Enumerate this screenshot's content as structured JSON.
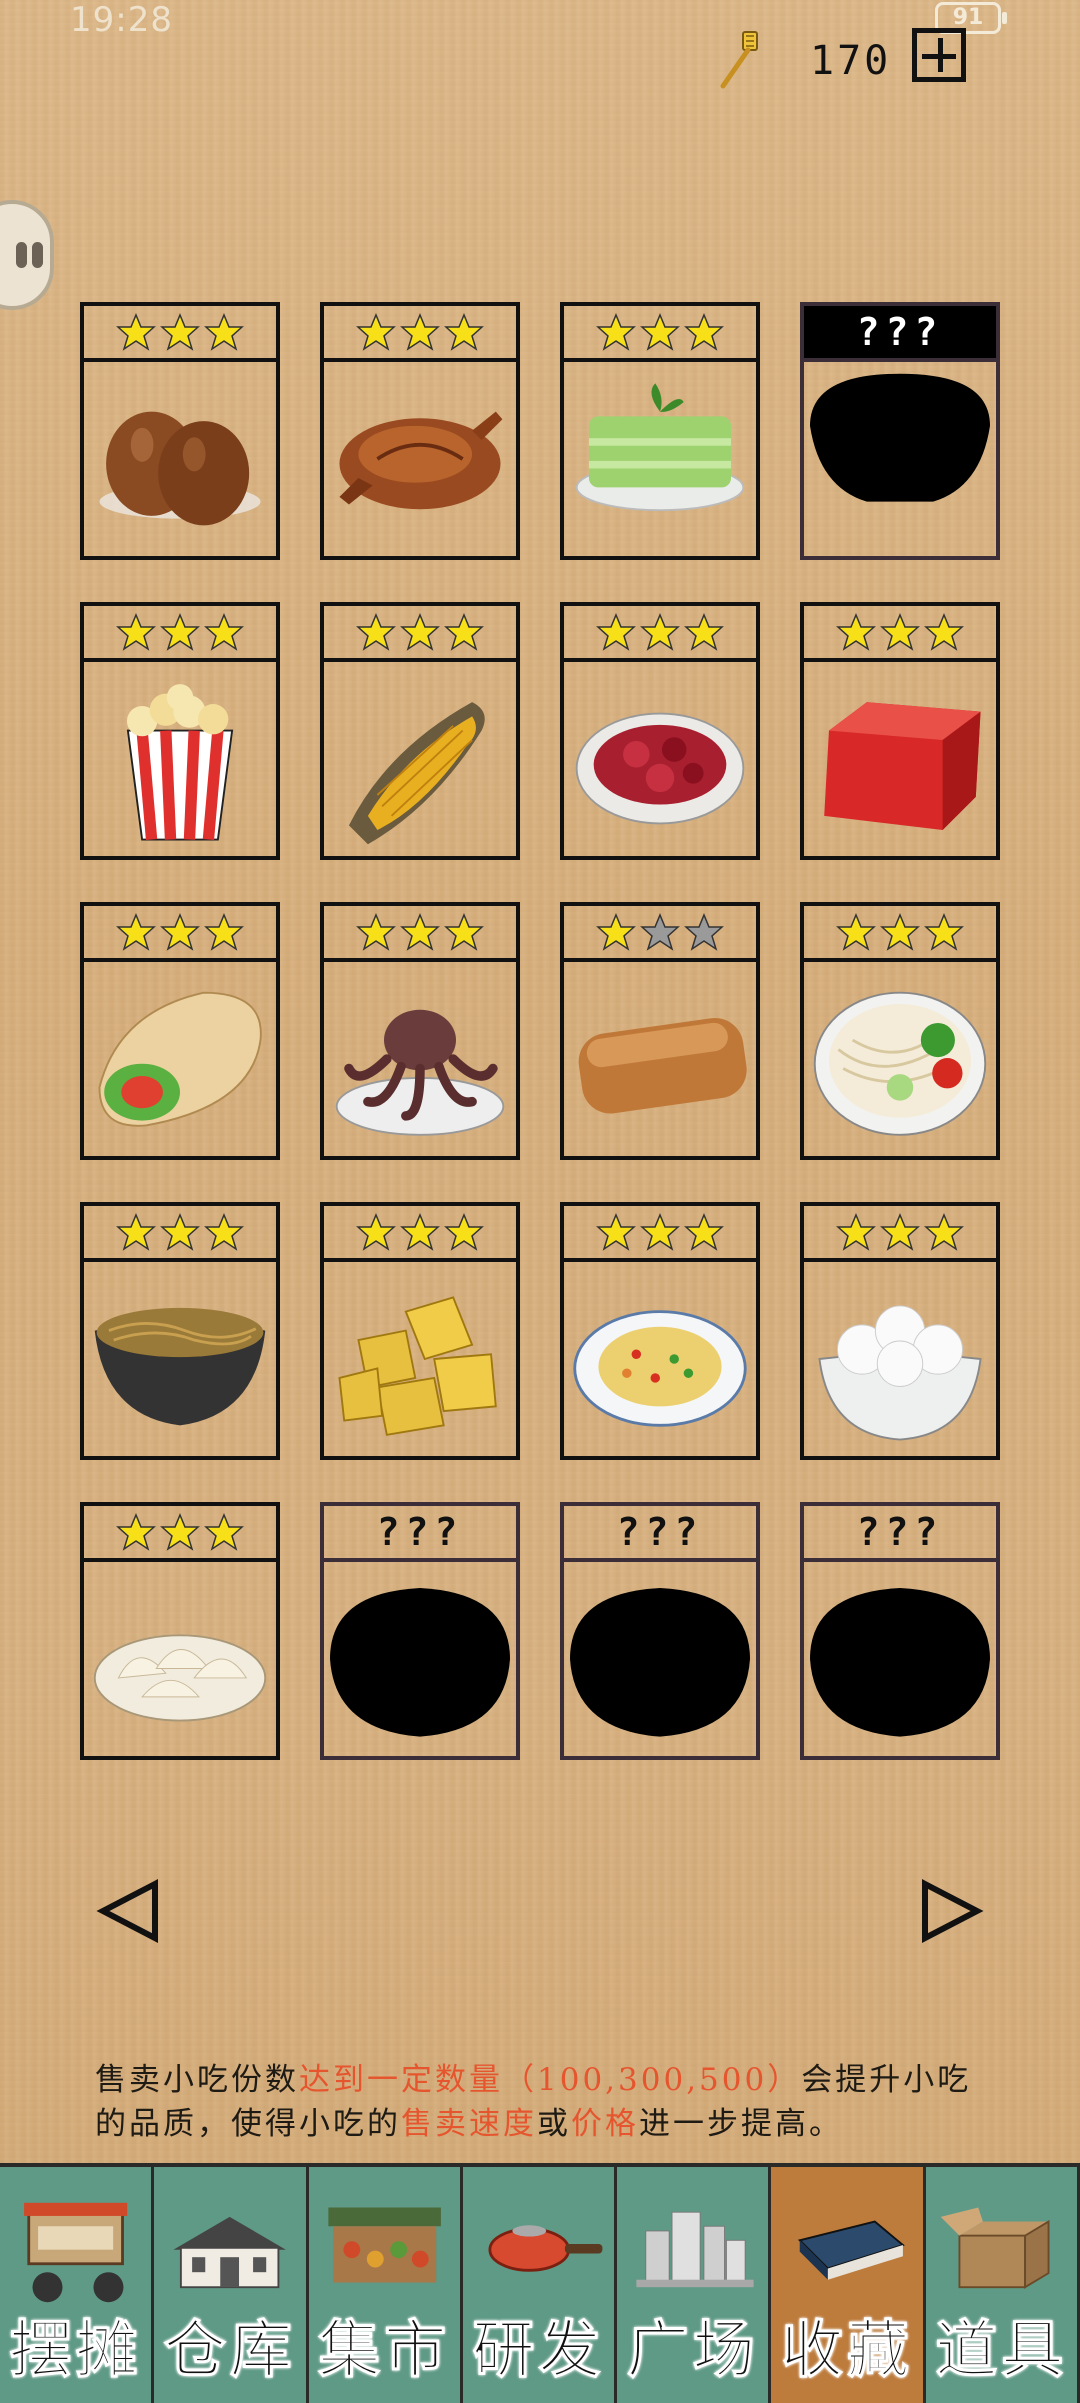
{
  "status_bar": {
    "time": "19:28",
    "battery": "91"
  },
  "currency": {
    "amount": "170",
    "icon": "spatula-icon"
  },
  "cards": [
    {
      "name": "tea-eggs",
      "stars": 3,
      "locked": false,
      "dark_header": false,
      "art": "eggs"
    },
    {
      "name": "roast-chicken",
      "stars": 3,
      "locked": false,
      "dark_header": false,
      "art": "chicken"
    },
    {
      "name": "green-bean-cake",
      "stars": 3,
      "locked": false,
      "dark_header": false,
      "art": "greencake"
    },
    {
      "name": "unknown-1",
      "stars": 0,
      "locked": true,
      "dark_header": true,
      "label": "???",
      "art": "bowl"
    },
    {
      "name": "popcorn",
      "stars": 3,
      "locked": false,
      "dark_header": false,
      "art": "popcorn"
    },
    {
      "name": "roasted-corn",
      "stars": 3,
      "locked": false,
      "dark_header": false,
      "art": "corn"
    },
    {
      "name": "braised-meat",
      "stars": 3,
      "locked": false,
      "dark_header": false,
      "art": "meat"
    },
    {
      "name": "red-tofu",
      "stars": 3,
      "locked": false,
      "dark_header": false,
      "art": "tofu"
    },
    {
      "name": "pancake-roll",
      "stars": 3,
      "locked": false,
      "dark_header": false,
      "art": "roll"
    },
    {
      "name": "octopus",
      "stars": 3,
      "locked": false,
      "dark_header": false,
      "art": "octopus"
    },
    {
      "name": "fried-dough",
      "stars": 1,
      "locked": false,
      "dark_header": false,
      "art": "dough"
    },
    {
      "name": "noodles-bowl",
      "stars": 3,
      "locked": false,
      "dark_header": false,
      "art": "noodlebowl"
    },
    {
      "name": "dark-noodles",
      "stars": 3,
      "locked": false,
      "dark_header": false,
      "art": "darknoodles"
    },
    {
      "name": "crackers",
      "stars": 3,
      "locked": false,
      "dark_header": false,
      "art": "crackers"
    },
    {
      "name": "fried-rice",
      "stars": 3,
      "locked": false,
      "dark_header": false,
      "art": "rice"
    },
    {
      "name": "rice-balls",
      "stars": 3,
      "locked": false,
      "dark_header": false,
      "art": "balls"
    },
    {
      "name": "dumplings",
      "stars": 3,
      "locked": false,
      "dark_header": false,
      "art": "dumplings"
    },
    {
      "name": "unknown-2",
      "stars": 0,
      "locked": true,
      "dark_header": false,
      "label": "???",
      "art": "blob"
    },
    {
      "name": "unknown-3",
      "stars": 0,
      "locked": true,
      "dark_header": false,
      "label": "???",
      "art": "blob"
    },
    {
      "name": "unknown-4",
      "stars": 0,
      "locked": true,
      "dark_header": false,
      "label": "???",
      "art": "blob"
    }
  ],
  "info_text": {
    "p1": "售卖小吃份数",
    "h1": "达到一定数量（100,300,500）",
    "p2": "会提升小吃的品质，使得小吃的",
    "h2": "售卖速度",
    "p3": "或",
    "h3": "价格",
    "p4": "进一步提高。"
  },
  "nav": [
    {
      "label": "摆摊",
      "icon": "food-cart-icon",
      "active": false
    },
    {
      "label": "仓库",
      "icon": "warehouse-icon",
      "active": false
    },
    {
      "label": "集市",
      "icon": "market-stall-icon",
      "active": false
    },
    {
      "label": "研发",
      "icon": "frying-pan-icon",
      "active": false
    },
    {
      "label": "广场",
      "icon": "city-plaza-icon",
      "active": false
    },
    {
      "label": "收藏",
      "icon": "book-icon",
      "active": true
    },
    {
      "label": "道具",
      "icon": "box-icon",
      "active": false
    }
  ],
  "colors": {
    "star": "#f7e018",
    "star_empty": "#9a9a9a",
    "nav_bg": "#5f9a86",
    "nav_active": "#bd7b3c",
    "highlight": "#e5562f"
  }
}
